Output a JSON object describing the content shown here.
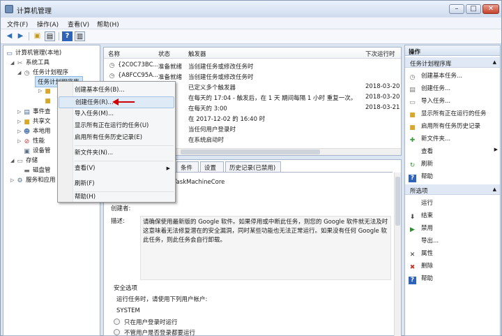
{
  "window": {
    "title": "计算机管理",
    "min": "–",
    "max": "□",
    "close": "✕"
  },
  "menubar": [
    "文件(F)",
    "操作(A)",
    "查看(V)",
    "帮助(H)"
  ],
  "tree": {
    "root": "计算机管理(本地)",
    "system_tools": "系统工具",
    "task_scheduler": "任务计划程序",
    "task_library": "任务计划程序库",
    "event_viewer": "事件查",
    "shared_folders": "共享文",
    "local_users": "本地用",
    "performance": "性能",
    "device_manager": "设备管",
    "storage": "存储",
    "disk_management": "磁盘管",
    "services": "服务和应用"
  },
  "task_list": {
    "columns": [
      "名称",
      "状态",
      "触发器",
      "下次运行时"
    ],
    "rows": [
      {
        "name": "{2C0C73BC...",
        "status": "准备就绪",
        "trigger": "当创建任务或修改任务时",
        "next": ""
      },
      {
        "name": "{A8FCC95A...",
        "status": "准备就绪",
        "trigger": "当创建任务或修改任务时",
        "next": ""
      },
      {
        "name": "",
        "status": "",
        "trigger": "已定义多个触发器",
        "next": "2018-03-20"
      },
      {
        "name": "",
        "status": "",
        "trigger": "在每天的 17:04 - 触发后，在 1 天 期间每隔 1 小时 重复一次。",
        "next": "2018-03-20"
      },
      {
        "name": "",
        "status": "",
        "trigger": "在每天的 3:00",
        "next": "2018-03-21"
      },
      {
        "name": "",
        "status": "",
        "trigger": "在 2017-12-02 的 16:40 时",
        "next": ""
      },
      {
        "name": "",
        "status": "",
        "trigger": "当任何用户登录时",
        "next": ""
      },
      {
        "name": "",
        "status": "",
        "trigger": "在系统启动时",
        "next": ""
      }
    ]
  },
  "detail": {
    "tabs": [
      "条件",
      "设置",
      "历史记录(已禁用)"
    ],
    "task_name": "ateTaskMachineCore",
    "author_label": "创建者:",
    "desc_label": "描述:",
    "desc_lines": [
      "请确保使用最新版的 Google 软件。如果停用或中断此任务，则您的 Google 软件就无法及时",
      "这意味着无法修复潜在的安全漏洞，同时某些功能也无法正常运行。如果没有任何 Google 软",
      "此任务，则此任务会自行卸载。"
    ],
    "security_title": "安全选项",
    "run_as_label": "运行任务时，请使用下列用户帐户:",
    "run_as_user": "SYSTEM",
    "radio1": "只在用户登录时运行",
    "radio2": "不管用户是否登录都要运行"
  },
  "context_menu": {
    "items": [
      "创建基本任务(B)...",
      "创建任务(R)...",
      "导入任务(M)...",
      "显示所有正在运行的任务(U)",
      "启用所有任务历史记录(E)",
      "新文件夹(N)...",
      "查看(V)",
      "刷新(F)",
      "帮助(H)"
    ]
  },
  "actions": {
    "header": "操作",
    "section1": "任务计划程序库",
    "items1": [
      "创建基本任务...",
      "创建任务...",
      "导入任务...",
      "显示所有正在运行的任务",
      "启用所有任务历史记录",
      "新文件夹...",
      "查看",
      "刷新",
      "帮助"
    ],
    "section2": "所选项",
    "items2": [
      "运行",
      "结束",
      "禁用",
      "导出...",
      "属性",
      "删除",
      "帮助"
    ]
  },
  "colors": {
    "accent": "#d00000",
    "selection": "#cde3f7"
  }
}
